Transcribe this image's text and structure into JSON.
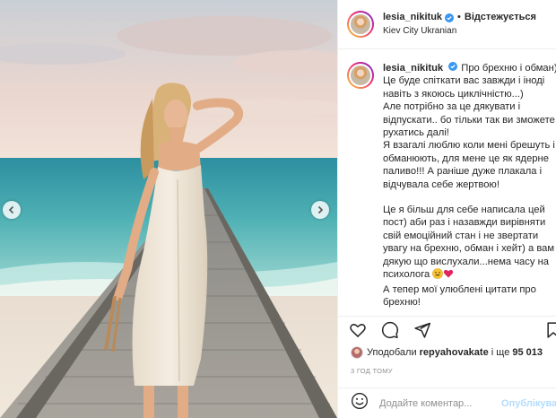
{
  "post": {
    "username": "lesia_nikituk",
    "follow_status": "Відстежується",
    "separator": "•",
    "location": "Kiev City Ukranian"
  },
  "caption": {
    "username": "lesia_nikituk",
    "first_line_text": "Про брехню і обман)",
    "lines": [
      "Це буде спіткати вас завжди і іноді",
      "навіть з якоюсь циклічністю...)",
      "Але потрібно за це дякувати і",
      "відпускати.. бо тільки так ви зможете",
      "рухатись далі!",
      "Я взагалі люблю коли мені брешуть і",
      "обманюють, для мене це як ядерне",
      "паливо!!! А раніше дуже плакала і",
      "відчувала себе жертвою!"
    ],
    "lines2": [
      "Це я більш для себе написала цей",
      "пост) аби раз і назавжди вирівняти",
      "свій емоційний стан і не звертати",
      "увагу на брехню, обман і хейт) а вам",
      "дякую що вислухали...нема часу на"
    ],
    "line_with_emoji": "психолога",
    "lines3": [
      "А тепер мої улюблені цитати про",
      "брехню!"
    ]
  },
  "likes": {
    "prefix": "Уподобали",
    "liker": "repyahovakate",
    "middle": "і ще",
    "count": "95 013"
  },
  "timestamp": "3 ГОД ТОМУ",
  "comment": {
    "placeholder": "Додайте коментар...",
    "publish_label": "Опублікувати"
  },
  "icons": {
    "verified": "verified-badge-icon",
    "like": "heart-outline-icon",
    "comment": "comment-bubble-icon",
    "share": "paper-plane-icon",
    "save": "bookmark-icon",
    "emoji": "smiley-icon",
    "carousel_prev": "chevron-left-icon",
    "carousel_next": "chevron-right-icon"
  },
  "colors": {
    "verified_blue": "#3897f0",
    "publish_disabled": "#b3dbff",
    "heart_red": "#e0245e",
    "muted_text": "#8e8e8e"
  }
}
